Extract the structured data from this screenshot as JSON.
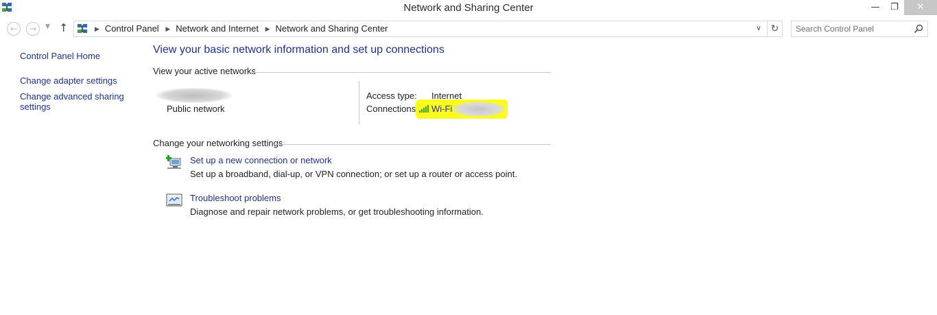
{
  "window": {
    "title": "Network and Sharing Center",
    "min_glyph": "—",
    "max_glyph": "❐",
    "close_glyph": "✕"
  },
  "nav": {
    "back_glyph": "←",
    "forward_glyph": "→",
    "dropdown_glyph": "▼",
    "up_glyph": "↑",
    "breadcrumb": [
      "Control Panel",
      "Network and Internet",
      "Network and Sharing Center"
    ],
    "address_dropdown_glyph": "∨",
    "refresh_glyph": "↻",
    "search_placeholder": "Search Control Panel"
  },
  "sidebar": {
    "home": "Control Panel Home",
    "adapter": "Change adapter settings",
    "sharing": "Change advanced sharing settings"
  },
  "main": {
    "title": "View your basic network information and set up connections",
    "active_networks_heading": "View your active networks",
    "network": {
      "category": "Public network",
      "access_type_label": "Access type:",
      "access_type_value": "Internet",
      "connections_label": "Connections:",
      "connection_value": "Wi-Fi"
    },
    "networking_heading": "Change your networking settings",
    "tasks": [
      {
        "link": "Set up a new connection or network",
        "description": "Set up a broadband, dial-up, or VPN connection; or set up a router or access point."
      },
      {
        "link": "Troubleshoot problems",
        "description": "Diagnose and repair network problems, or get troubleshooting information."
      }
    ]
  },
  "colors": {
    "link": "#1e3287",
    "highlight": "#fbfb1e",
    "wifi_bars": "#3aa02a",
    "divider": "#c8c8c8"
  },
  "icons": {
    "app": "network-control-panel-icon",
    "search": "magnifier-icon",
    "wifi": "wifi-signal-icon",
    "new_connection": "new-connection-icon",
    "troubleshoot": "troubleshoot-icon"
  }
}
